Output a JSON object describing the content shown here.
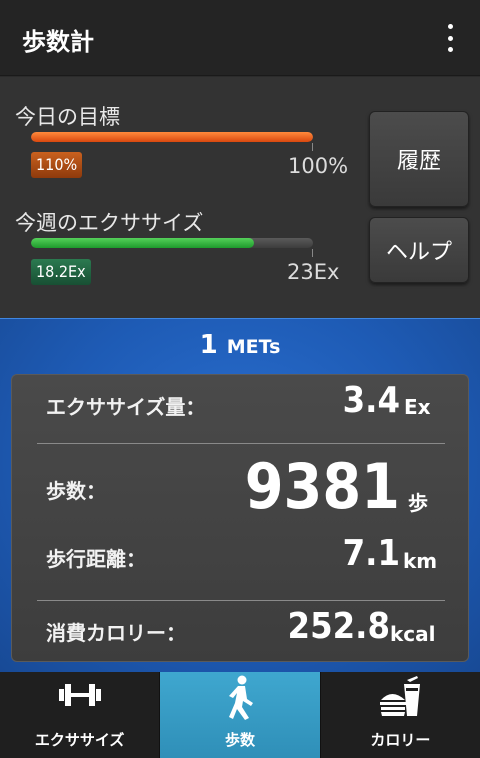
{
  "app": {
    "title": "歩数計",
    "menu_icon": "more-vert-icon"
  },
  "goals": {
    "daily": {
      "label": "今日の目標",
      "progress_percent": 110,
      "badge": "110%",
      "target": "100%",
      "color": "#f26522"
    },
    "weekly": {
      "label": "今週のエクササイズ",
      "progress_percent": 79,
      "badge": "18.2Ex",
      "target": "23Ex",
      "color": "#2fb33a"
    },
    "history_button": "履歴",
    "help_button": "ヘルプ"
  },
  "mets": {
    "value": "1",
    "unit": "METs"
  },
  "stats": {
    "exercise": {
      "label": "エクササイズ量：",
      "value": "3.4",
      "unit": "Ex"
    },
    "steps": {
      "label": "歩数：",
      "value": "9381",
      "unit": "歩"
    },
    "distance": {
      "label": "歩行距離：",
      "value": "7.1",
      "unit": "km"
    },
    "calories": {
      "label": "消費カロリー：",
      "value": "252.8",
      "unit": "kcal"
    }
  },
  "nav": {
    "tabs": [
      {
        "label": "エクササイズ",
        "icon": "dumbbell-icon",
        "active": false
      },
      {
        "label": "歩数",
        "icon": "walking-person-icon",
        "active": true
      },
      {
        "label": "カロリー",
        "icon": "burger-drink-icon",
        "active": false
      }
    ]
  },
  "colors": {
    "accent_blue": "#1e5bb5",
    "active_tab": "#3a9fc8"
  }
}
